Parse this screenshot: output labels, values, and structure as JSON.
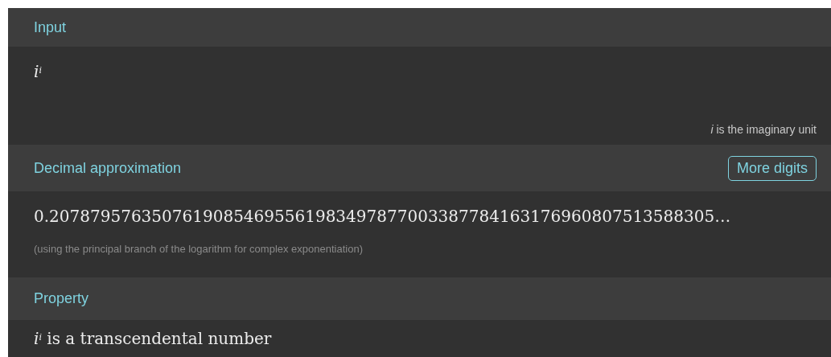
{
  "pods": [
    {
      "title": "Input",
      "kind": "input",
      "result": "*i*$^{i}$",
      "note": "*i* is the imaginary unit"
    },
    {
      "title": "Decimal approximation",
      "kind": "decimal",
      "button": "More digits",
      "result": "0.20787957635076190854695561983497877003387784163176960807513588305…",
      "note": "(using the principal branch of the logarithm for complex exponentiation)"
    },
    {
      "title": "Property",
      "kind": "property",
      "result": "*i*$^{i}$ is a transcendental number"
    }
  ]
}
